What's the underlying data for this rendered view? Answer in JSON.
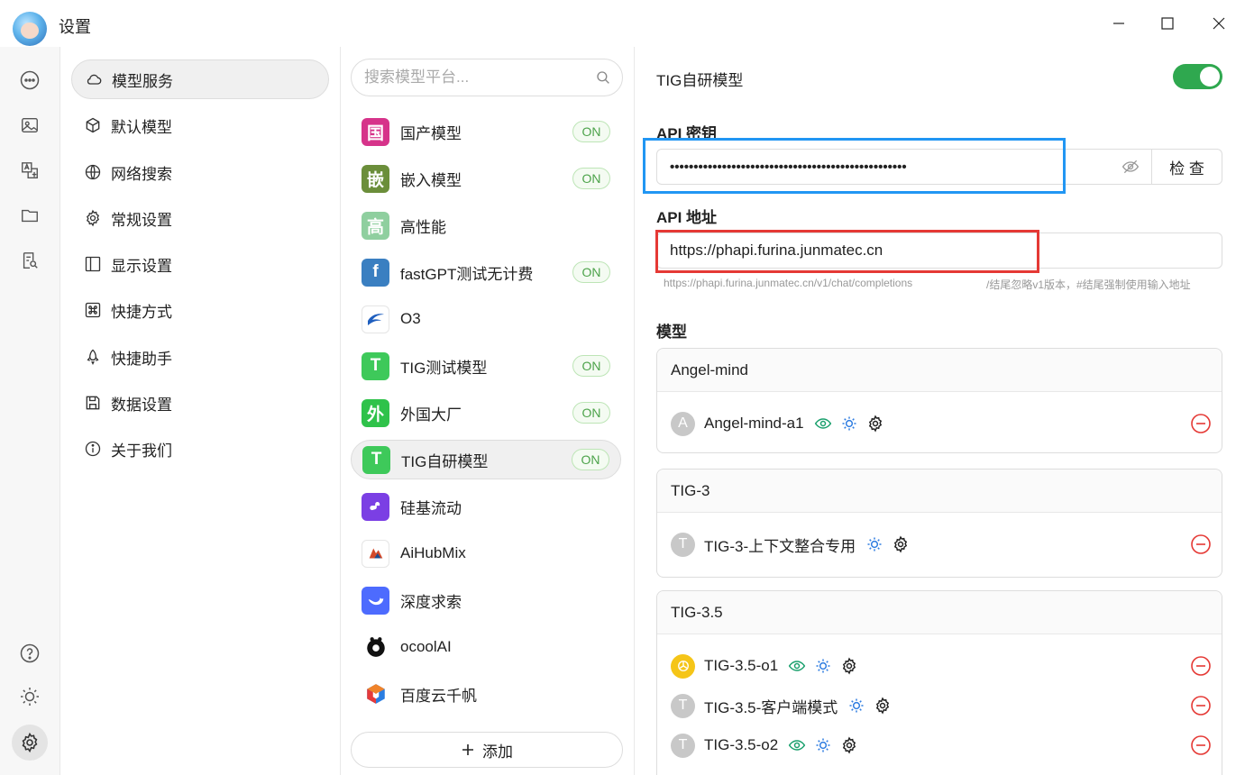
{
  "window": {
    "title": "设置"
  },
  "nav": {
    "items": [
      {
        "label": "模型服务",
        "icon": "cloud-icon"
      },
      {
        "label": "默认模型",
        "icon": "cube-icon"
      },
      {
        "label": "网络搜索",
        "icon": "globe-icon"
      },
      {
        "label": "常规设置",
        "icon": "gear-icon"
      },
      {
        "label": "显示设置",
        "icon": "layout-icon"
      },
      {
        "label": "快捷方式",
        "icon": "command-icon"
      },
      {
        "label": "快捷助手",
        "icon": "rocket-icon"
      },
      {
        "label": "数据设置",
        "icon": "save-icon"
      },
      {
        "label": "关于我们",
        "icon": "info-icon"
      }
    ]
  },
  "providers": {
    "search_placeholder": "搜索模型平台...",
    "on_label": "ON",
    "items": [
      {
        "logo": "国",
        "name": "国产模型",
        "on": true,
        "color": "#d6338a"
      },
      {
        "logo": "嵌",
        "name": "嵌入模型",
        "on": true,
        "color": "#6b8e3a"
      },
      {
        "logo": "高",
        "name": "高性能",
        "on": false,
        "color": "#8fcf9f"
      },
      {
        "logo": "f",
        "name": "fastGPT测试无计费",
        "on": true,
        "color": "#3a7fc1"
      },
      {
        "logo": "",
        "name": "O3",
        "on": false,
        "color": "#ffffff"
      },
      {
        "logo": "T",
        "name": "TIG测试模型",
        "on": true,
        "color": "#3ec95a"
      },
      {
        "logo": "外",
        "name": "外国大厂",
        "on": true,
        "color": "#2fc24a"
      },
      {
        "logo": "T",
        "name": "TIG自研模型",
        "on": true,
        "color": "#3ec95a"
      },
      {
        "logo": "",
        "name": "硅基流动",
        "on": false,
        "color": "#7b3fe4"
      },
      {
        "logo": "",
        "name": "AiHubMix",
        "on": false,
        "color": "#ffffff"
      },
      {
        "logo": "",
        "name": "深度求索",
        "on": false,
        "color": "#4d6bfe"
      },
      {
        "logo": "",
        "name": "ocoolAI",
        "on": false,
        "color": "#111111"
      },
      {
        "logo": "",
        "name": "百度云千帆",
        "on": false,
        "color": "#ffffff"
      }
    ],
    "add_label": "添加"
  },
  "detail": {
    "title": "TIG自研模型",
    "enabled": true,
    "api_key_label": "API 密钥",
    "api_key_value": "••••••••••••••••••••••••••••••••••••••••••••••••••",
    "check_label": "检 查",
    "api_url_label": "API 地址",
    "api_url_value": "https://phapi.furina.junmatec.cn",
    "hint_url": "https://phapi.furina.junmatec.cn/v1/chat/completions",
    "hint_note": "/结尾忽略v1版本，#结尾强制使用输入地址",
    "models_label": "模型",
    "groups": [
      {
        "name": "Angel-mind",
        "models": [
          {
            "avatar": "A",
            "name": "Angel-mind-a1",
            "vision": true,
            "reason": true
          }
        ]
      },
      {
        "name": "TIG-3",
        "models": [
          {
            "avatar": "T",
            "name": "TIG-3-上下文整合专用",
            "vision": false,
            "reason": true
          }
        ]
      },
      {
        "name": "TIG-3.5",
        "models": [
          {
            "avatar": "",
            "name": "TIG-3.5-o1",
            "vision": true,
            "reason": true
          },
          {
            "avatar": "T",
            "name": "TIG-3.5-客户端模式",
            "vision": false,
            "reason": true
          },
          {
            "avatar": "T",
            "name": "TIG-3.5-o2",
            "vision": true,
            "reason": true
          }
        ]
      }
    ]
  }
}
